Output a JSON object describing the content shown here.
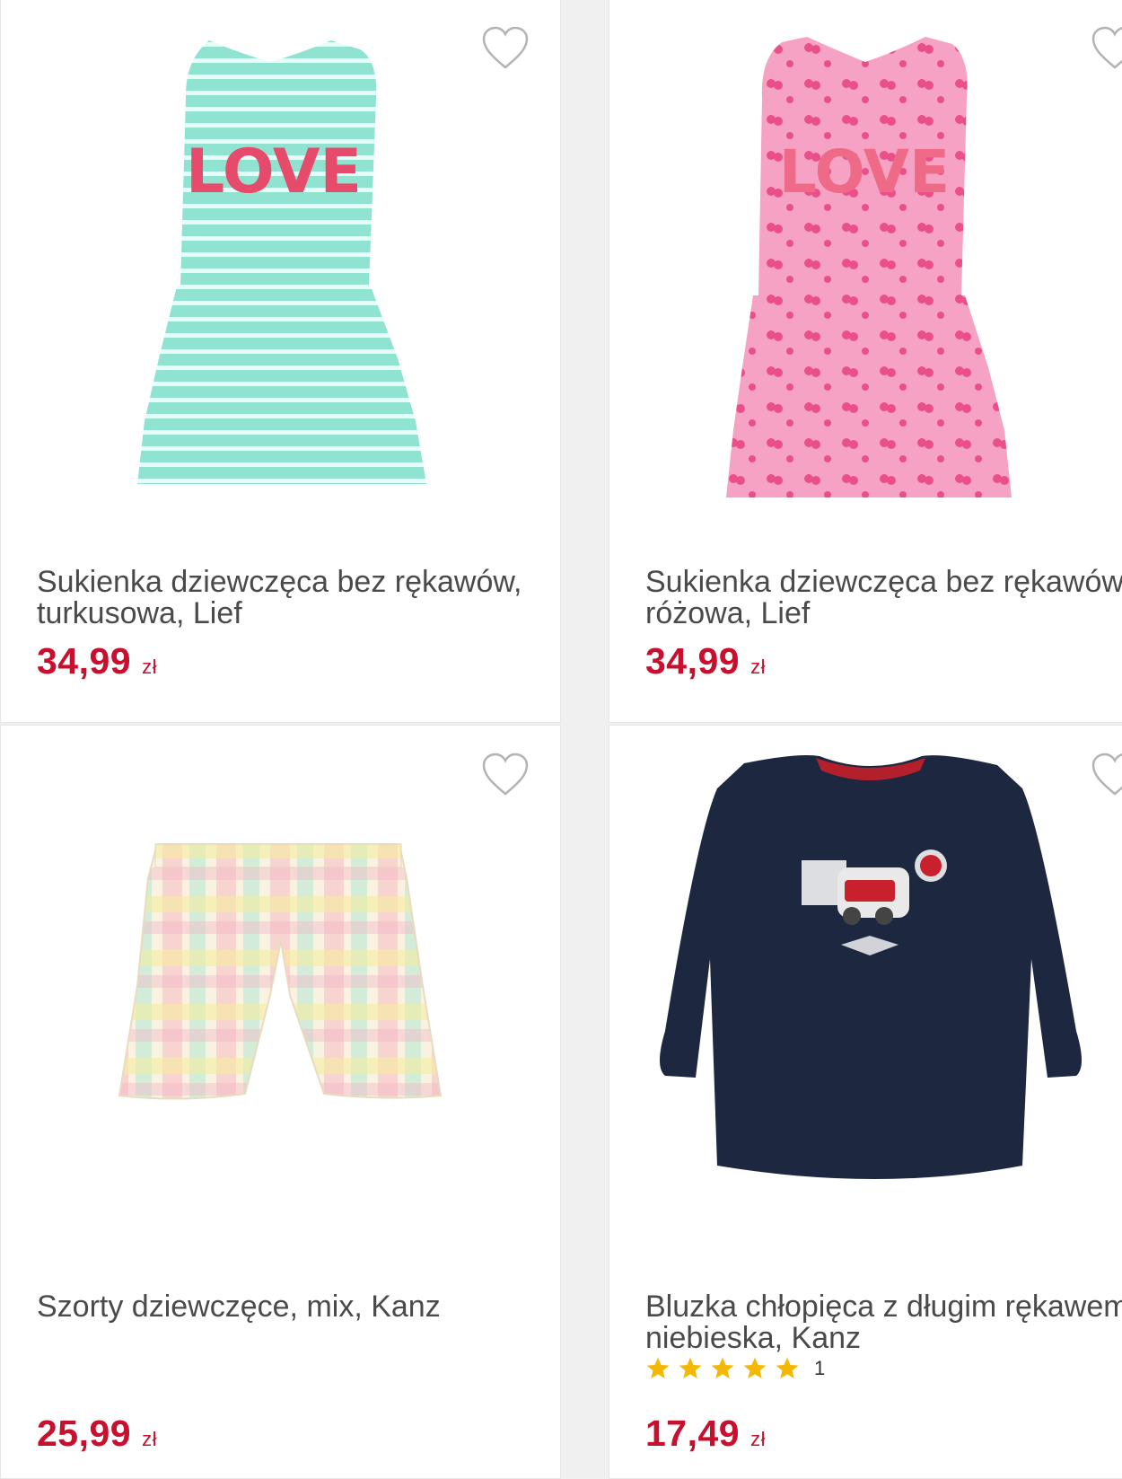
{
  "colors": {
    "price": "#c8102e",
    "star": "#f5b800",
    "heart": "#b3b3b3"
  },
  "products": [
    {
      "title": "Sukienka dziewczęca bez rękawów, turkusowa, Lief",
      "price": "34,99",
      "currency": "zł",
      "image_icon": "teal-striped-dress-image",
      "image_text": "LOVE"
    },
    {
      "title": "Sukienka dziewczęca bez rękawów, różowa, Lief",
      "price": "34,99",
      "currency": "zł",
      "image_icon": "pink-cherry-dress-image",
      "image_text": "LOVE"
    },
    {
      "title": "Szorty dziewczęce, mix, Kanz",
      "price": "25,99",
      "currency": "zł",
      "image_icon": "pastel-plaid-shorts-image"
    },
    {
      "title": "Bluzka chłopięca z długim rękawem, niebieska, Kanz",
      "price": "17,49",
      "currency": "zł",
      "rating": {
        "stars": 5,
        "count": "1"
      },
      "image_icon": "navy-longsleeve-shirt-image"
    }
  ]
}
